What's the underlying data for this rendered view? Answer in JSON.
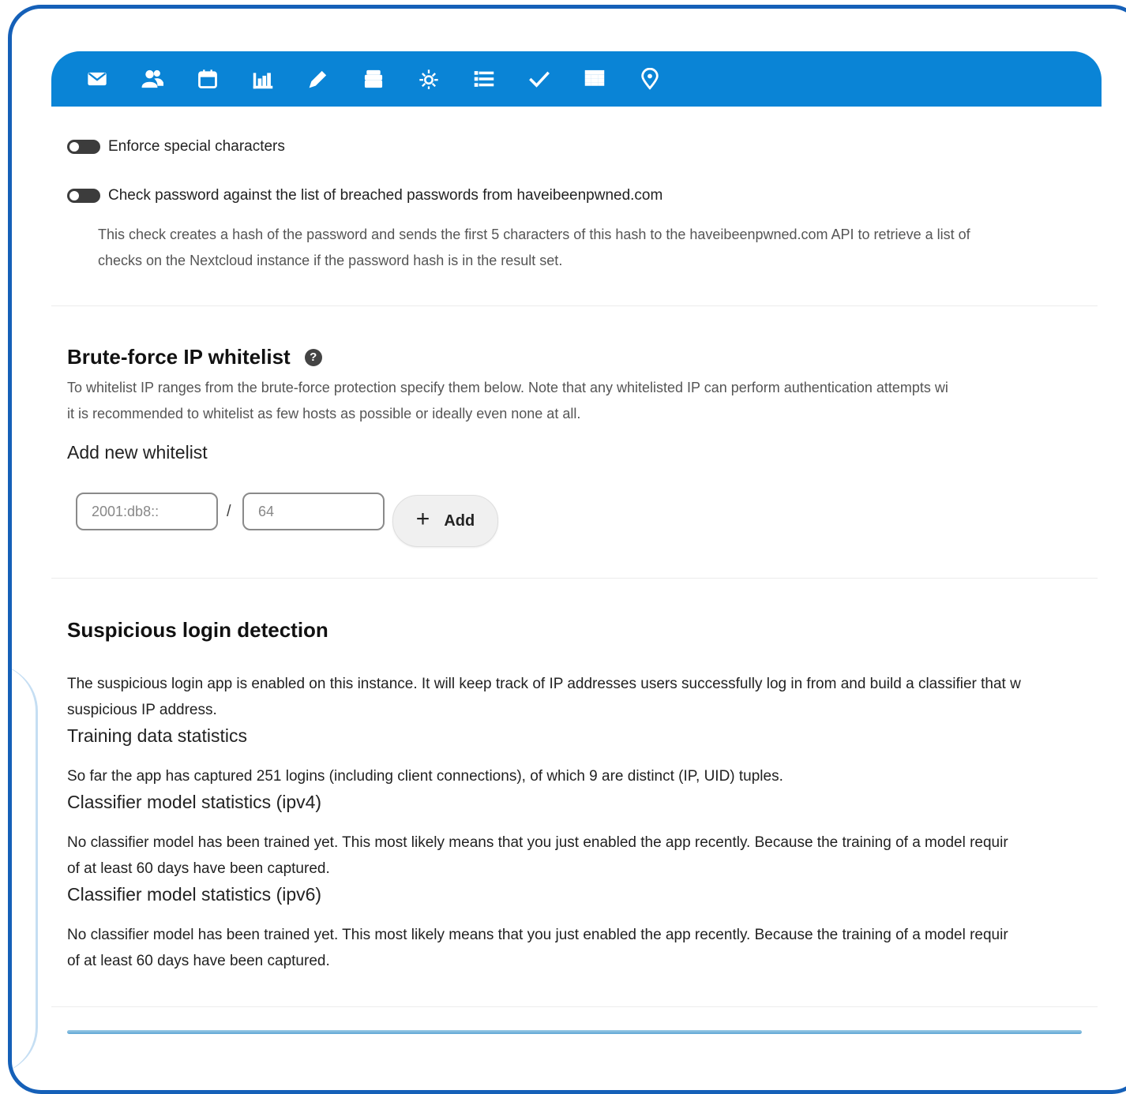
{
  "toolbar": {
    "icons": [
      "mail-icon",
      "contacts-icon",
      "calendar-icon",
      "chart-icon",
      "pencil-icon",
      "files-stack-icon",
      "sparkle-icon",
      "list-icon",
      "checkmark-icon",
      "table-icon",
      "location-pin-icon"
    ],
    "color": "#0a84d6"
  },
  "password_policy": {
    "enforce_special_label": "Enforce special characters",
    "check_breached_label": "Check password against the list of breached passwords from haveibeenpwned.com",
    "check_breached_desc_line1": "This check creates a hash of the password and sends the first 5 characters of this hash to the haveibeenpwned.com API to retrieve a list of",
    "check_breached_desc_line2": "checks on the Nextcloud instance if the password hash is in the result set."
  },
  "bruteforce": {
    "title": "Brute-force IP whitelist",
    "desc_line1": "To whitelist IP ranges from the brute-force protection specify them below. Note that any whitelisted IP can perform authentication attempts wi",
    "desc_line2": "it is recommended to whitelist as few hosts as possible or ideally even none at all.",
    "add_heading": "Add new whitelist",
    "ip_placeholder": "2001:db8::",
    "separator": "/",
    "mask_placeholder": "64",
    "add_plus": "+",
    "add_label": "Add"
  },
  "suspicious": {
    "title": "Suspicious login detection",
    "intro_line1": "The suspicious login app is enabled on this instance. It will keep track of IP addresses users successfully log in from and build a classifier that w",
    "intro_line2": "suspicious IP address.",
    "training_heading": "Training data statistics",
    "training_text": "So far the app has captured 251 logins (including client connections), of which 9 are distinct (IP, UID) tuples.",
    "ipv4_heading": "Classifier model statistics (ipv4)",
    "ipv4_line1": "No classifier model has been trained yet. This most likely means that you just enabled the app recently. Because the training of a model requir",
    "ipv4_line2": "of at least 60 days have been captured.",
    "ipv6_heading": "Classifier model statistics (ipv6)",
    "ipv6_line1": "No classifier model has been trained yet. This most likely means that you just enabled the app recently. Because the training of a model requir",
    "ipv6_line2": "of at least 60 days have been captured."
  }
}
